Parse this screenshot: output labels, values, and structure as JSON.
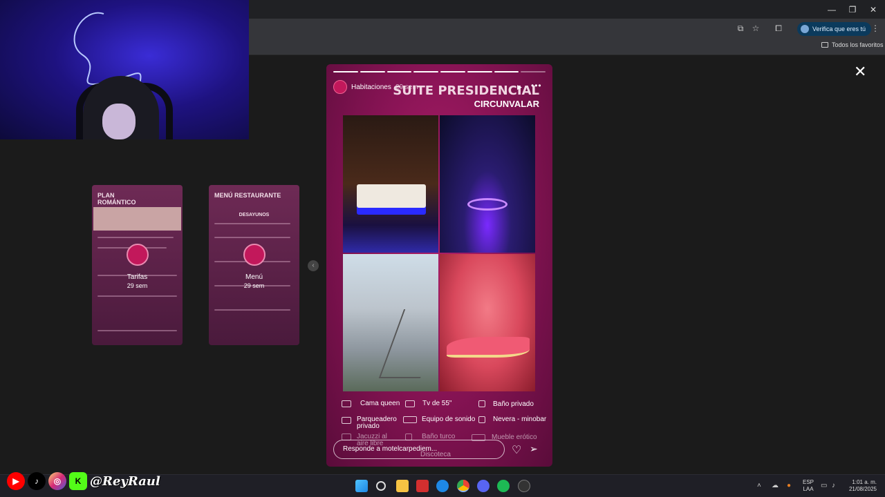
{
  "browser": {
    "verify_label": "Verifica que eres tú",
    "favorites_label": "Todos los favoritos",
    "minimize": "—",
    "restore": "❐",
    "close": "✕"
  },
  "thumbnails": [
    {
      "title": "PLAN ROMÁNTICO",
      "label": "Tarifas",
      "sub": "29 sem"
    },
    {
      "title": "MENÚ RESTAURANTE",
      "label": "Menú",
      "sub": "29 sem",
      "heading": "DESAYUNOS"
    }
  ],
  "story": {
    "username": "Habitaciones",
    "time": "29 sem",
    "title": "SUITE PRESIDENCIAL",
    "subtitle": "CIRCUNVALAR",
    "amenities": [
      {
        "label": "Cama queen"
      },
      {
        "label": "Tv de 55\""
      },
      {
        "label": "Baño privado"
      },
      {
        "label": "Parqueadero privado"
      },
      {
        "label": "Equipo de sonido"
      },
      {
        "label": "Nevera - minobar"
      },
      {
        "label": "Jacuzzi al aire libre"
      },
      {
        "label": "Baño turco"
      },
      {
        "label": "Mueble erótico"
      },
      {
        "label": "Discoteca"
      }
    ],
    "reply_placeholder": "Responde a motelcarpediem..."
  },
  "taskbar": {
    "lang_top": "ESP",
    "lang_bottom": "LAA",
    "time": "1:01 a. m.",
    "date": "21/08/2025"
  },
  "overlay": {
    "handle": "@ReyRaul"
  },
  "colors": {
    "story_bg": "#8a1456",
    "accent": "#c2185b",
    "verify_bg": "#0b3a5c"
  }
}
